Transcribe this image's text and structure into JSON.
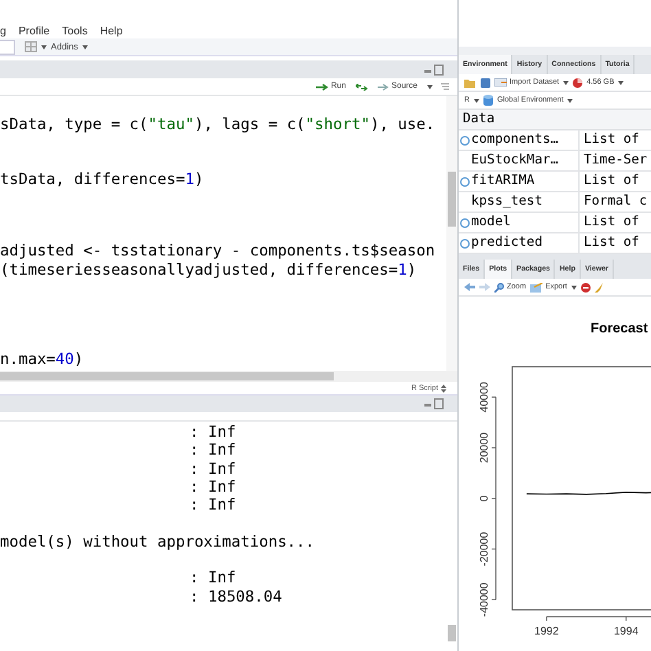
{
  "menu": [
    "g",
    "Profile",
    "Tools",
    "Help"
  ],
  "toolbar": {
    "addins": "Addins"
  },
  "editor": {
    "buttons": [
      "Run",
      "Source"
    ],
    "lines": [
      {
        "kind": "code",
        "segments": [
          {
            "kind": "plain",
            "text": "sData, type = c("
          },
          {
            "kind": "string",
            "text": "\"tau\""
          },
          {
            "kind": "plain",
            "text": "), lags = c("
          },
          {
            "kind": "string",
            "text": "\"short\""
          },
          {
            "kind": "plain",
            "text": "), use."
          }
        ]
      },
      {
        "kind": "blank"
      },
      {
        "kind": "blank"
      },
      {
        "kind": "code",
        "segments": [
          {
            "kind": "plain",
            "text": "tsData, differences="
          },
          {
            "kind": "number",
            "text": "1"
          },
          {
            "kind": "plain",
            "text": ")"
          }
        ]
      },
      {
        "kind": "blank"
      },
      {
        "kind": "blank"
      },
      {
        "kind": "blank"
      },
      {
        "kind": "code",
        "segments": [
          {
            "kind": "plain",
            "text": "adjusted <- tsstationary - components.ts$season"
          }
        ]
      },
      {
        "kind": "code",
        "segments": [
          {
            "kind": "plain",
            "text": "(timeseriesseasonallyadjusted, differences="
          },
          {
            "kind": "number",
            "text": "1"
          },
          {
            "kind": "plain",
            "text": ")"
          }
        ]
      },
      {
        "kind": "blank"
      },
      {
        "kind": "blank"
      },
      {
        "kind": "blank"
      },
      {
        "kind": "blank"
      },
      {
        "kind": "code",
        "segments": [
          {
            "kind": "plain",
            "text": "n.max="
          },
          {
            "kind": "number",
            "text": "40"
          },
          {
            "kind": "plain",
            "text": ")"
          }
        ]
      }
    ],
    "status": "R Script"
  },
  "console": {
    "lines": [
      {
        "kind": "result",
        "text": ": Inf"
      },
      {
        "kind": "result",
        "text": ": Inf"
      },
      {
        "kind": "result",
        "text": ": Inf"
      },
      {
        "kind": "result",
        "text": ": Inf"
      },
      {
        "kind": "result",
        "text": ": Inf"
      },
      {
        "kind": "blank"
      },
      {
        "kind": "message",
        "text": "model(s) without approximations..."
      },
      {
        "kind": "blank"
      },
      {
        "kind": "result",
        "text": ": Inf"
      },
      {
        "kind": "result",
        "text": ": 18508.04"
      }
    ]
  },
  "environment": {
    "tabs": [
      {
        "label": "Environment",
        "selected": true
      },
      {
        "label": "History",
        "selected": false
      },
      {
        "label": "Connections",
        "selected": false
      },
      {
        "label": "Tutoria",
        "selected": false
      }
    ],
    "import": "Import Dataset",
    "memory": "4.56 GB",
    "language": "R",
    "scope": "Global Environment",
    "section": "Data",
    "rows": [
      {
        "name": "components…",
        "value": "List of",
        "expandable": true
      },
      {
        "name": "EuStockMar…",
        "value": "Time-Ser",
        "expandable": false
      },
      {
        "name": "fitARIMA",
        "value": "List of",
        "expandable": true
      },
      {
        "name": "kpss_test",
        "value": "Formal c",
        "expandable": false
      },
      {
        "name": "model",
        "value": "List of",
        "expandable": true
      },
      {
        "name": "predicted",
        "value": "List of",
        "expandable": true
      }
    ]
  },
  "plots": {
    "tabs": [
      {
        "label": "Files",
        "selected": false
      },
      {
        "label": "Plots",
        "selected": true
      },
      {
        "label": "Packages",
        "selected": false
      },
      {
        "label": "Help",
        "selected": false
      },
      {
        "label": "Viewer",
        "selected": false
      }
    ],
    "zoom": "Zoom",
    "export": "Export",
    "chart_data": {
      "type": "line",
      "title": "Forecast",
      "x": [
        1991.5,
        1992,
        1992.5,
        1993,
        1993.5,
        1994,
        1994.5,
        1994.66
      ],
      "series": [
        {
          "color": "#000000",
          "values": [
            1800,
            1700,
            1800,
            1600,
            1900,
            2400,
            2200,
            2300
          ]
        }
      ],
      "xlim": [
        1991.14,
        1994.66
      ],
      "ylim": [
        -44000,
        52000
      ],
      "xticks": [
        1992,
        1994
      ],
      "yticks": [
        -40000,
        -20000,
        0,
        20000,
        40000
      ]
    }
  }
}
